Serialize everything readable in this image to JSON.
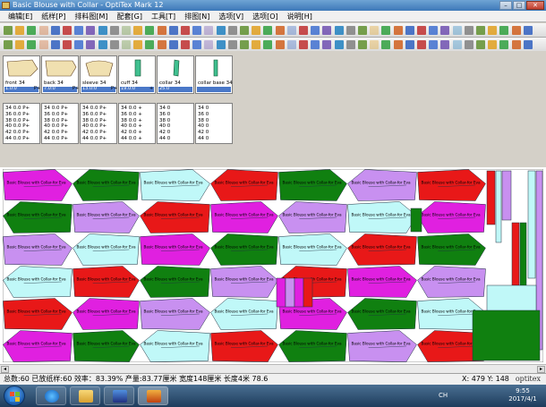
{
  "window": {
    "title": "Basic Blouse with Collar - OptiTex Mark 12",
    "controls": {
      "minimize": "–",
      "maximize": "□",
      "close": "✕"
    }
  },
  "menu": [
    "编辑[E]",
    "纸样[P]",
    "排料图[M]",
    "配套[G]",
    "工具[T]",
    "排图[N]",
    "选项[V]",
    "选项[O]",
    "说明[H]"
  ],
  "pieces": [
    {
      "name": "front 34",
      "count": "1.0:0",
      "plus": "P+",
      "color": "#f0e0b0"
    },
    {
      "name": "back 34",
      "count": "7.0:0",
      "plus": "P+",
      "color": "#f0e0b0"
    },
    {
      "name": "sleeve 34",
      "count": "13.0:0",
      "plus": "P+",
      "color": "#f0e0b0"
    },
    {
      "name": "cuff 34",
      "count": "19.0:0",
      "plus": "+",
      "color": "#40c090"
    },
    {
      "name": "collar 34",
      "count": "25.0",
      "plus": "",
      "color": "#40c090"
    },
    {
      "name": "collar base 34",
      "count": "",
      "plus": "",
      "color": "#40c090"
    }
  ],
  "size_tables": [
    [
      "34  0.0 P+",
      "36  0.0 P+",
      "38  0.0 P+",
      "40  0.0 P+",
      "42  0.0 P+",
      "44  0.0 P+"
    ],
    [
      "34  0.0 P+",
      "36  0.0 P+",
      "38  0.0 P+",
      "40  0.0 P+",
      "42  0.0 P+",
      "44  0.0 P+"
    ],
    [
      "34  0.0 P+",
      "36  0.0 P+",
      "38  0.0 P+",
      "40  0.0 P+",
      "42  0.0 P+",
      "44  0.0 P+"
    ],
    [
      "34  0.0 +",
      "36  0.0 +",
      "38  0.0 +",
      "40  0.0 +",
      "42  0.0 +",
      "44  0.0 +"
    ],
    [
      "34  0",
      "36  0",
      "38  0",
      "40  0",
      "42  0",
      "44  0"
    ],
    [
      "34  0",
      "36  0",
      "38  0",
      "40  0",
      "42  0",
      "44  0"
    ]
  ],
  "marker": {
    "piece_label": "Basic Blouse with Collar-for Eva",
    "colors": {
      "magenta": "#e020e0",
      "lavender": "#c890f0",
      "red": "#e81818",
      "green": "#108010",
      "cyan": "#c0f8f8",
      "outline": "#203040"
    }
  },
  "status": {
    "total": "总数:60",
    "placed": "已放纸样:60",
    "efficiency": "效率：83.39%",
    "yield": "产量:83.77厘米",
    "width": "宽度148厘米",
    "length": "长度4米 78.6",
    "x": "X: 479",
    "y": "Y: 148",
    "brand": "optitex"
  },
  "taskbar": {
    "lang": "CH",
    "time": "9:55",
    "date": "2017/4/1"
  }
}
